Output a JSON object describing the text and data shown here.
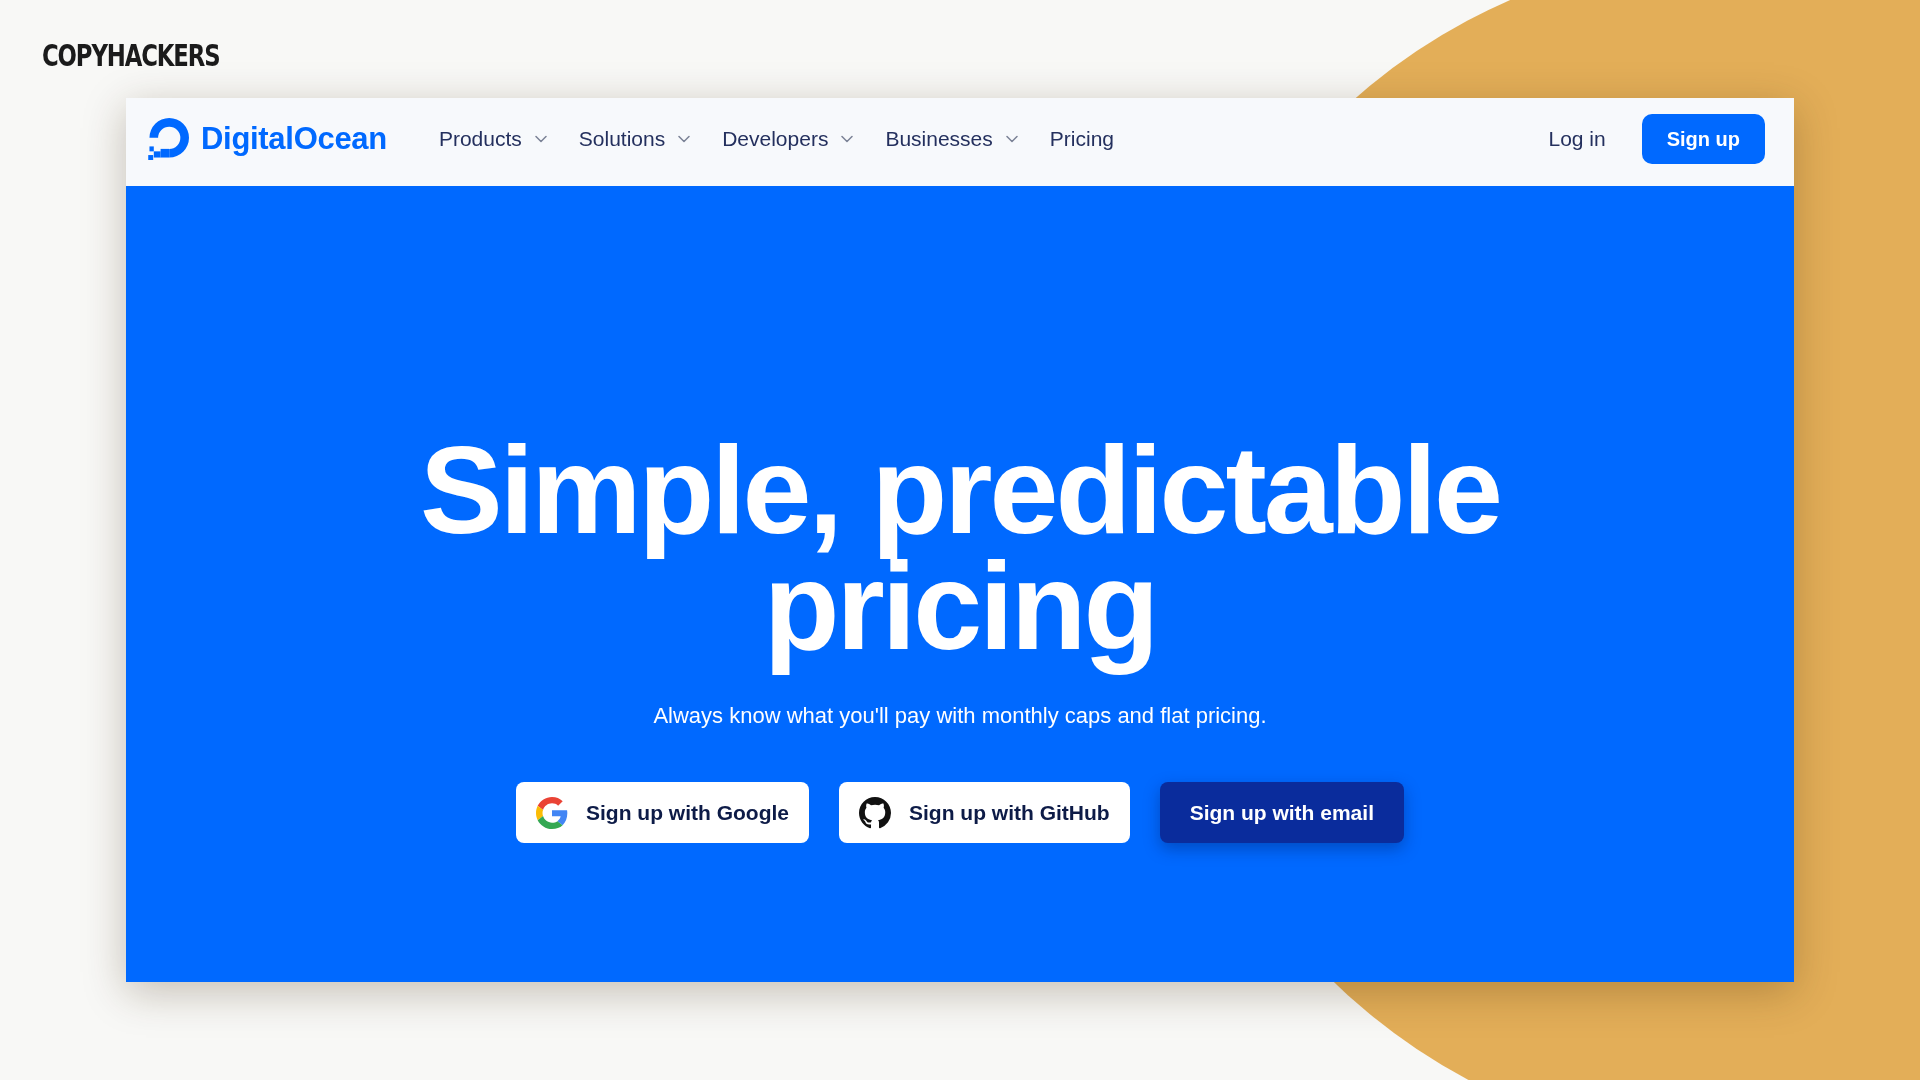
{
  "brand": {
    "label": "COPYHACKERS"
  },
  "site": {
    "logo": {
      "label": "DigitalOcean"
    },
    "nav": [
      {
        "label": "Products",
        "has_menu": true
      },
      {
        "label": "Solutions",
        "has_menu": true
      },
      {
        "label": "Developers",
        "has_menu": true
      },
      {
        "label": "Businesses",
        "has_menu": true
      },
      {
        "label": "Pricing",
        "has_menu": false
      }
    ],
    "login": "Log in",
    "signup": "Sign up"
  },
  "hero": {
    "title": "Simple, predictable pricing",
    "subtitle": "Always know what you'll pay with monthly caps and flat pricing.",
    "buttons": [
      {
        "kind": "google",
        "label": "Sign up with Google"
      },
      {
        "kind": "github",
        "label": "Sign up with GitHub"
      },
      {
        "kind": "email",
        "label": "Sign up with email"
      }
    ]
  }
}
